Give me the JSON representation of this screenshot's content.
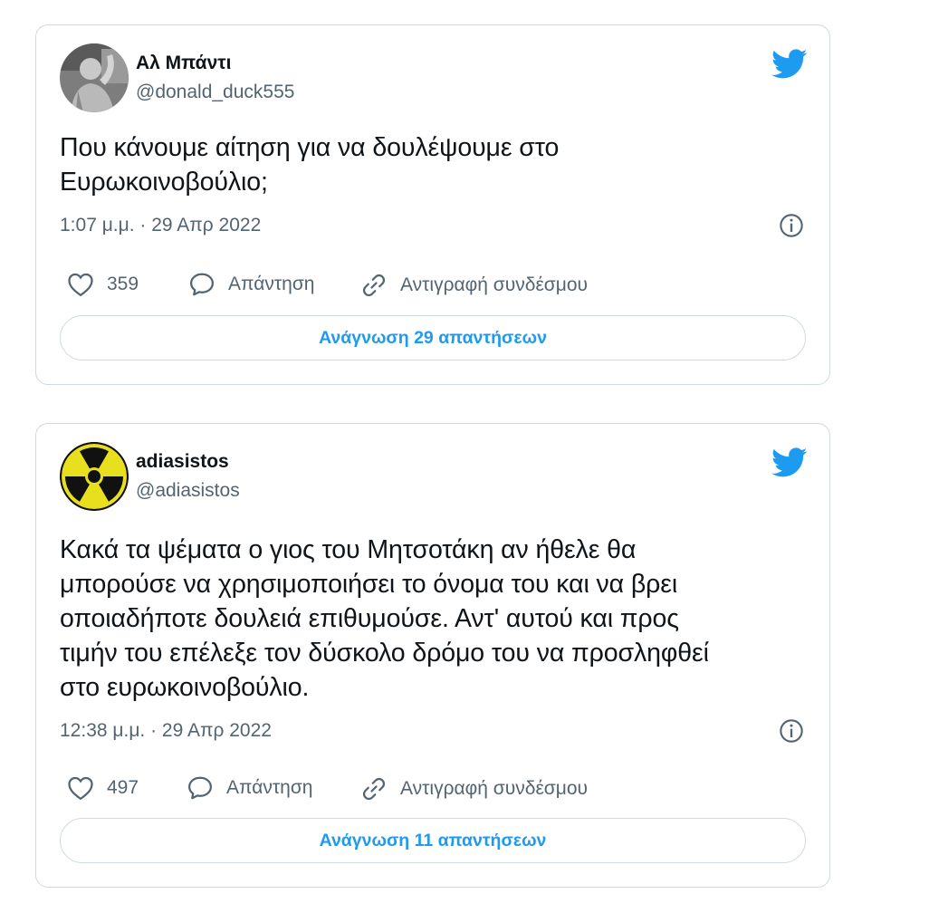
{
  "tweets": [
    {
      "display_name": "Αλ Μπάντι",
      "handle": "@donald_duck555",
      "text_lines": [
        "Που κάνουμε αίτηση για να δουλέψουμε στο",
        "Ευρωκοινοβούλιο;"
      ],
      "timestamp": "1:07 μ.μ. · 29 Απρ 2022",
      "likes": "359",
      "reply_label": "Απάντηση",
      "copy_link_label": "Αντιγραφή συνδέσμου",
      "read_replies_label": "Ανάγνωση 29 απαντήσεων"
    },
    {
      "display_name": "adiasistos",
      "handle": "@adiasistos",
      "text_lines": [
        "Κακά τα ψέματα ο γιος του Μητσοτάκη αν ήθελε θα",
        "μπορούσε να χρησιμοποιήσει το όνομα του και να βρει",
        "οποιαδήποτε δουλειά επιθυμούσε. Αντ' αυτού και προς",
        "τιμήν του επέλεξε τον δύσκολο δρόμο του να προσληφθεί",
        "στο ευρωκοινοβούλιο."
      ],
      "timestamp": "12:38 μ.μ. · 29 Απρ 2022",
      "likes": "497",
      "reply_label": "Απάντηση",
      "copy_link_label": "Αντιγραφή συνδέσμου",
      "read_replies_label": "Ανάγνωση 11 απαντήσεων"
    }
  ],
  "colors": {
    "accent": "#1d9bf0",
    "secondary_text": "#536471",
    "border": "#cfd9de",
    "primary_text": "#0f1419"
  },
  "icons": [
    "twitter-bird-icon",
    "info-icon",
    "heart-icon",
    "reply-bubble-icon",
    "link-icon",
    "radiation-avatar"
  ]
}
